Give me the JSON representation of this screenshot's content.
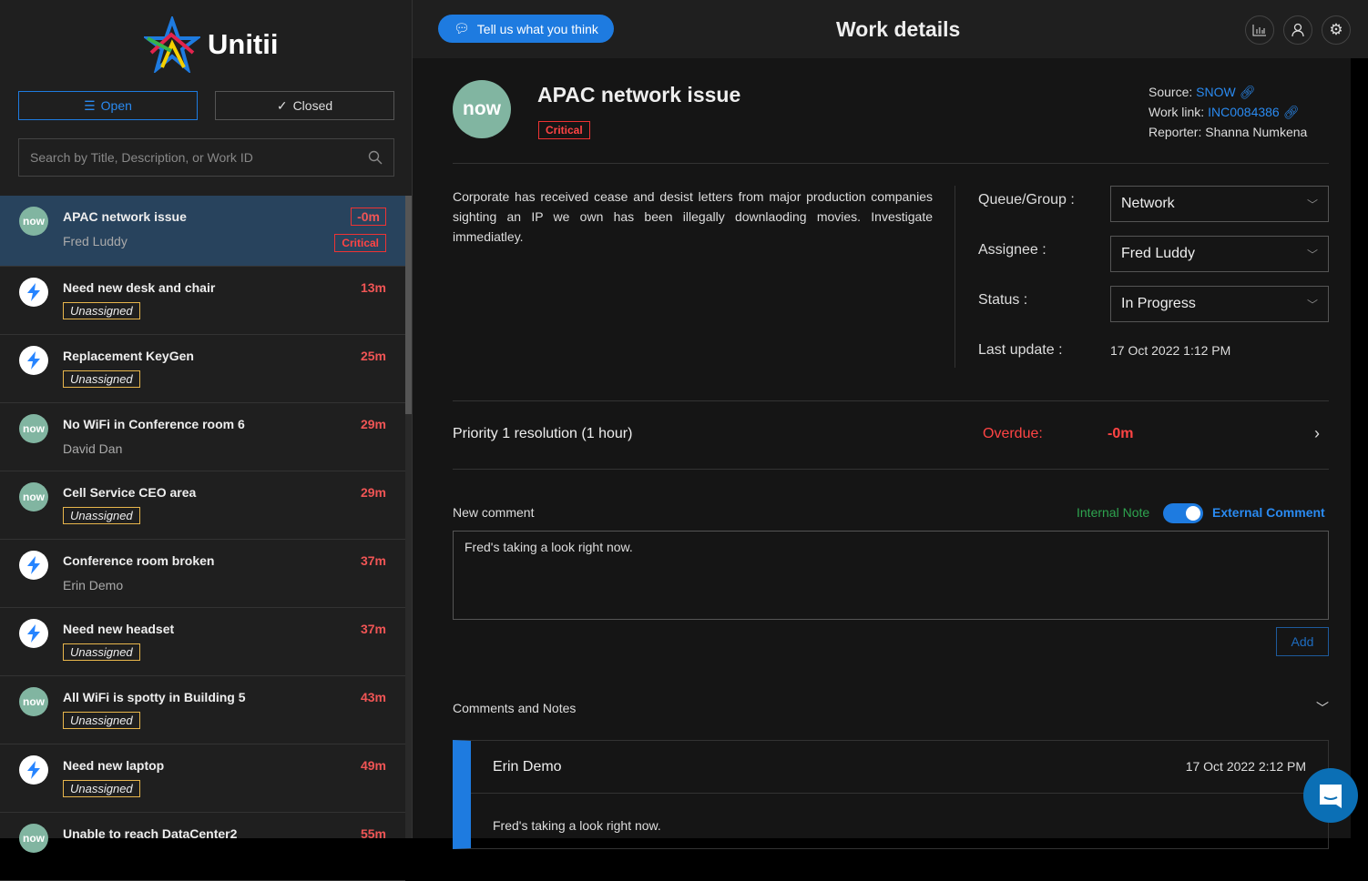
{
  "app": {
    "logo": "Unitii"
  },
  "sidebar": {
    "open_label": "Open",
    "closed_label": "Closed",
    "search_placeholder": "Search by Title, Description, or Work ID",
    "items": [
      {
        "title": "APAC network issue",
        "sub": "Fred Luddy",
        "time": "-0m",
        "badge": "Critical",
        "source": "now",
        "unassigned": false
      },
      {
        "title": "Need new desk and chair",
        "sub": "Unassigned",
        "time": "13m",
        "source": "jira",
        "unassigned": true
      },
      {
        "title": "Replacement KeyGen",
        "sub": "Unassigned",
        "time": "25m",
        "source": "jira",
        "unassigned": true
      },
      {
        "title": "No WiFi in Conference room 6",
        "sub": "David Dan",
        "time": "29m",
        "source": "now",
        "unassigned": false
      },
      {
        "title": "Cell Service CEO area",
        "sub": "Unassigned",
        "time": "29m",
        "source": "now",
        "unassigned": true
      },
      {
        "title": "Conference room broken",
        "sub": "Erin Demo",
        "time": "37m",
        "source": "jira",
        "unassigned": false
      },
      {
        "title": "Need new headset",
        "sub": "Unassigned",
        "time": "37m",
        "source": "jira",
        "unassigned": true
      },
      {
        "title": "All WiFi is spotty in Building 5",
        "sub": "Unassigned",
        "time": "43m",
        "source": "now",
        "unassigned": true
      },
      {
        "title": "Need new laptop",
        "sub": "Unassigned",
        "time": "49m",
        "source": "jira",
        "unassigned": true
      },
      {
        "title": "Unable to reach DataCenter2",
        "sub": "",
        "time": "55m",
        "source": "now",
        "unassigned": false
      }
    ]
  },
  "header": {
    "feedback": "Tell us what you think",
    "title": "Work details"
  },
  "work": {
    "avatar": "now",
    "title": "APAC network issue",
    "priority": "Critical",
    "source_label": "Source:",
    "source": "SNOW",
    "link_label": "Work link:",
    "link": "INC0084386",
    "reporter_label": "Reporter:",
    "reporter": "Shanna Numkena",
    "description": "Corporate has received cease and desist letters from major production companies sighting an IP we own has been illegally downlaoding movies. Investigate immediatley.",
    "queue_label": "Queue/Group",
    "queue": "Network",
    "assignee_label": "Assignee",
    "assignee": "Fred Luddy",
    "status_label": "Status",
    "status": "In Progress",
    "update_label": "Last update",
    "update": "17 Oct 2022 1:12 PM",
    "sla": "Priority 1 resolution (1 hour)",
    "overdue_label": "Overdue:",
    "overdue": "-0m"
  },
  "comment": {
    "label": "New comment",
    "internal": "Internal Note",
    "external": "External Comment",
    "toggle_external": true,
    "text": "Fred's taking a look right now.",
    "add": "Add"
  },
  "comments": {
    "title": "Comments and Notes",
    "items": [
      {
        "author": "Erin Demo",
        "date": "17 Oct 2022 2:12 PM",
        "text": "Fred's taking a look right now."
      }
    ]
  },
  "colors": {
    "accent": "#1e7be0",
    "danger": "#f44444",
    "internal": "#2ea44f"
  }
}
